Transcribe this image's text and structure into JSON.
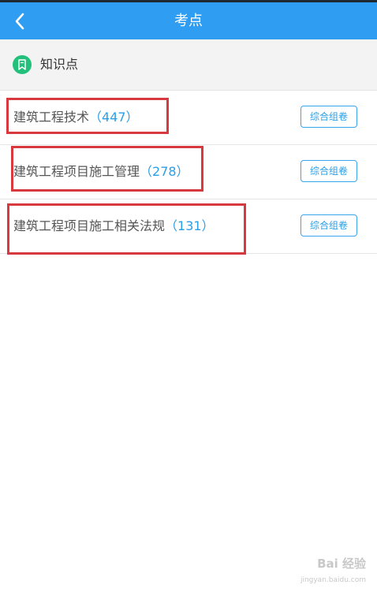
{
  "header": {
    "title": "考点"
  },
  "section": {
    "title": "知识点"
  },
  "items": [
    {
      "name": "建筑工程技术",
      "count": "（447）",
      "button": "综合组卷"
    },
    {
      "name": "建筑工程项目施工管理",
      "count": "（278）",
      "button": "综合组卷"
    },
    {
      "name": "建筑工程项目施工相关法规",
      "count": "（131）",
      "button": "综合组卷"
    }
  ],
  "watermark": {
    "brand": "Bai 经验",
    "url": "jingyan.baidu.com"
  },
  "colors": {
    "header": "#2f9df1",
    "accent": "#2a9fe6",
    "icon_green": "#22c07a",
    "highlight_red": "#d63a3f"
  },
  "icons": {
    "back": "chevron-left-icon",
    "section": "bookmark-icon"
  }
}
